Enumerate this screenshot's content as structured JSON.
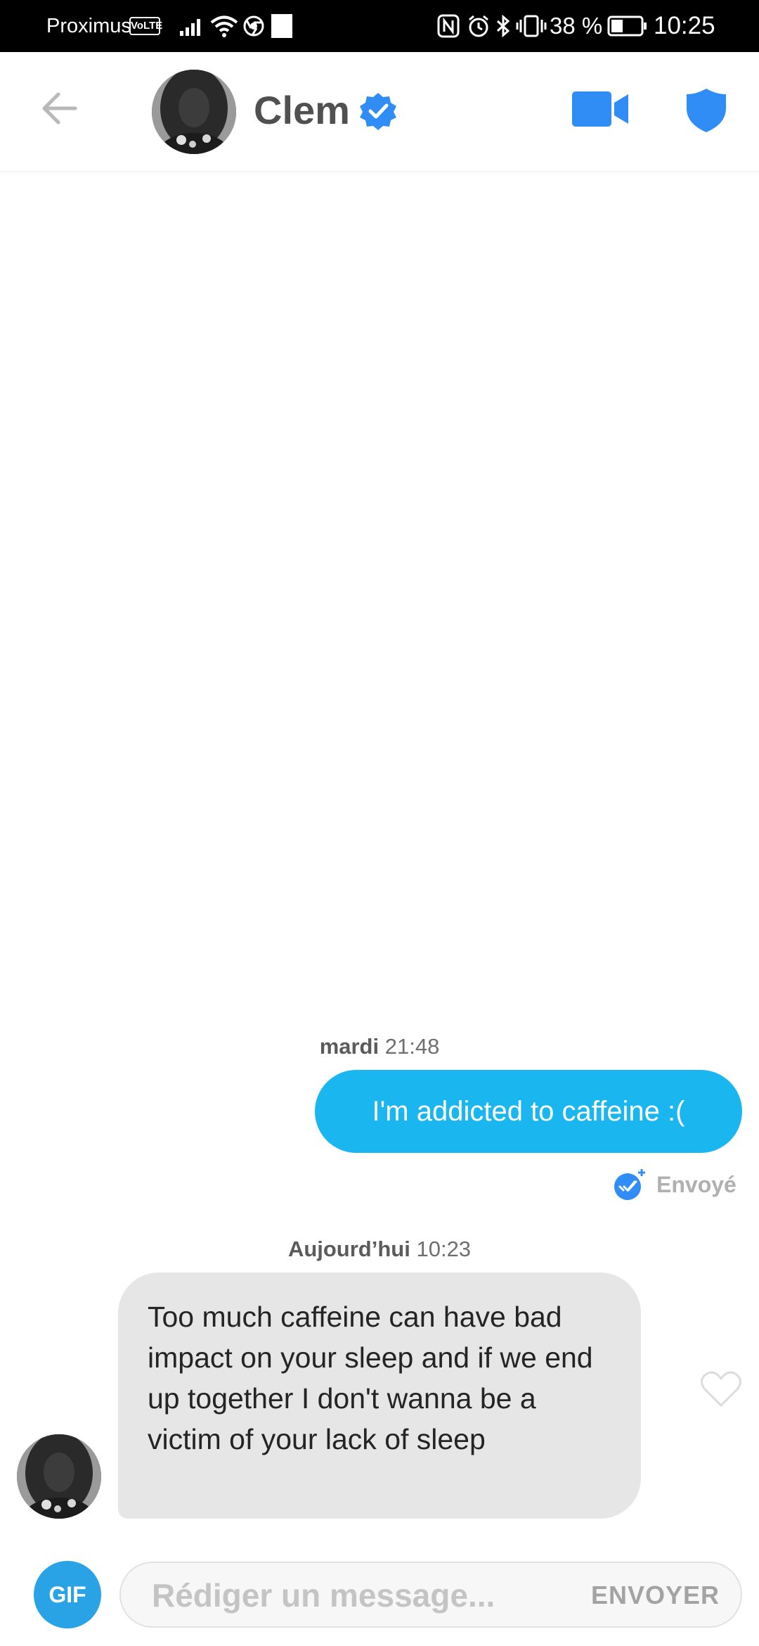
{
  "status_bar": {
    "carrier": "Proximus",
    "volte": "VoLTE",
    "battery": "38 %",
    "time": "10:25"
  },
  "header": {
    "name": "Clem",
    "accent": "#2f8df5"
  },
  "messages": {
    "ts1_day": "mardi",
    "ts1_time": "21:48",
    "outgoing": "I'm addicted to caffeine :(",
    "status": "Envoyé",
    "ts2_day": "Aujourd’hui",
    "ts2_time": "10:23",
    "incoming": "Too much caffeine can have bad impact on your sleep and if we end up together I don't wanna be a victim of your lack of sleep",
    "outgoing_color": "#1ab6ef",
    "incoming_color": "#e6e6e6"
  },
  "composer": {
    "gif_label": "GIF",
    "placeholder": "Rédiger un message...",
    "send_label": "ENVOYER"
  }
}
